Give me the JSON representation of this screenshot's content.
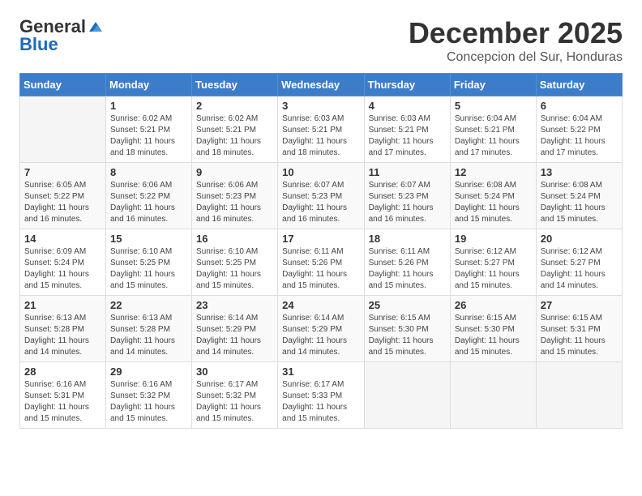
{
  "logo": {
    "general": "General",
    "blue": "Blue"
  },
  "header": {
    "month": "December 2025",
    "location": "Concepcion del Sur, Honduras"
  },
  "weekdays": [
    "Sunday",
    "Monday",
    "Tuesday",
    "Wednesday",
    "Thursday",
    "Friday",
    "Saturday"
  ],
  "weeks": [
    [
      {
        "day": "",
        "info": ""
      },
      {
        "day": "1",
        "info": "Sunrise: 6:02 AM\nSunset: 5:21 PM\nDaylight: 11 hours\nand 18 minutes."
      },
      {
        "day": "2",
        "info": "Sunrise: 6:02 AM\nSunset: 5:21 PM\nDaylight: 11 hours\nand 18 minutes."
      },
      {
        "day": "3",
        "info": "Sunrise: 6:03 AM\nSunset: 5:21 PM\nDaylight: 11 hours\nand 18 minutes."
      },
      {
        "day": "4",
        "info": "Sunrise: 6:03 AM\nSunset: 5:21 PM\nDaylight: 11 hours\nand 17 minutes."
      },
      {
        "day": "5",
        "info": "Sunrise: 6:04 AM\nSunset: 5:21 PM\nDaylight: 11 hours\nand 17 minutes."
      },
      {
        "day": "6",
        "info": "Sunrise: 6:04 AM\nSunset: 5:22 PM\nDaylight: 11 hours\nand 17 minutes."
      }
    ],
    [
      {
        "day": "7",
        "info": ""
      },
      {
        "day": "8",
        "info": "Sunrise: 6:06 AM\nSunset: 5:22 PM\nDaylight: 11 hours\nand 16 minutes."
      },
      {
        "day": "9",
        "info": "Sunrise: 6:06 AM\nSunset: 5:23 PM\nDaylight: 11 hours\nand 16 minutes."
      },
      {
        "day": "10",
        "info": "Sunrise: 6:07 AM\nSunset: 5:23 PM\nDaylight: 11 hours\nand 16 minutes."
      },
      {
        "day": "11",
        "info": "Sunrise: 6:07 AM\nSunset: 5:23 PM\nDaylight: 11 hours\nand 16 minutes."
      },
      {
        "day": "12",
        "info": "Sunrise: 6:08 AM\nSunset: 5:24 PM\nDaylight: 11 hours\nand 15 minutes."
      },
      {
        "day": "13",
        "info": "Sunrise: 6:08 AM\nSunset: 5:24 PM\nDaylight: 11 hours\nand 15 minutes."
      }
    ],
    [
      {
        "day": "14",
        "info": ""
      },
      {
        "day": "15",
        "info": "Sunrise: 6:10 AM\nSunset: 5:25 PM\nDaylight: 11 hours\nand 15 minutes."
      },
      {
        "day": "16",
        "info": "Sunrise: 6:10 AM\nSunset: 5:25 PM\nDaylight: 11 hours\nand 15 minutes."
      },
      {
        "day": "17",
        "info": "Sunrise: 6:11 AM\nSunset: 5:26 PM\nDaylight: 11 hours\nand 15 minutes."
      },
      {
        "day": "18",
        "info": "Sunrise: 6:11 AM\nSunset: 5:26 PM\nDaylight: 11 hours\nand 15 minutes."
      },
      {
        "day": "19",
        "info": "Sunrise: 6:12 AM\nSunset: 5:27 PM\nDaylight: 11 hours\nand 15 minutes."
      },
      {
        "day": "20",
        "info": "Sunrise: 6:12 AM\nSunset: 5:27 PM\nDaylight: 11 hours\nand 14 minutes."
      }
    ],
    [
      {
        "day": "21",
        "info": ""
      },
      {
        "day": "22",
        "info": "Sunrise: 6:13 AM\nSunset: 5:28 PM\nDaylight: 11 hours\nand 14 minutes."
      },
      {
        "day": "23",
        "info": "Sunrise: 6:14 AM\nSunset: 5:29 PM\nDaylight: 11 hours\nand 14 minutes."
      },
      {
        "day": "24",
        "info": "Sunrise: 6:14 AM\nSunset: 5:29 PM\nDaylight: 11 hours\nand 14 minutes."
      },
      {
        "day": "25",
        "info": "Sunrise: 6:15 AM\nSunset: 5:30 PM\nDaylight: 11 hours\nand 15 minutes."
      },
      {
        "day": "26",
        "info": "Sunrise: 6:15 AM\nSunset: 5:30 PM\nDaylight: 11 hours\nand 15 minutes."
      },
      {
        "day": "27",
        "info": "Sunrise: 6:15 AM\nSunset: 5:31 PM\nDaylight: 11 hours\nand 15 minutes."
      }
    ],
    [
      {
        "day": "28",
        "info": "Sunrise: 6:16 AM\nSunset: 5:31 PM\nDaylight: 11 hours\nand 15 minutes."
      },
      {
        "day": "29",
        "info": "Sunrise: 6:16 AM\nSunset: 5:32 PM\nDaylight: 11 hours\nand 15 minutes."
      },
      {
        "day": "30",
        "info": "Sunrise: 6:17 AM\nSunset: 5:32 PM\nDaylight: 11 hours\nand 15 minutes."
      },
      {
        "day": "31",
        "info": "Sunrise: 6:17 AM\nSunset: 5:33 PM\nDaylight: 11 hours\nand 15 minutes."
      },
      {
        "day": "",
        "info": ""
      },
      {
        "day": "",
        "info": ""
      },
      {
        "day": "",
        "info": ""
      }
    ]
  ],
  "week1_sunday_info": "Sunrise: 6:05 AM\nSunset: 5:22 PM\nDaylight: 11 hours\nand 16 minutes.",
  "week3_sunday_info": "Sunrise: 6:09 AM\nSunset: 5:24 PM\nDaylight: 11 hours\nand 15 minutes.",
  "week4_sunday_info": "Sunrise: 6:13 AM\nSunset: 5:28 PM\nDaylight: 11 hours\nand 14 minutes."
}
